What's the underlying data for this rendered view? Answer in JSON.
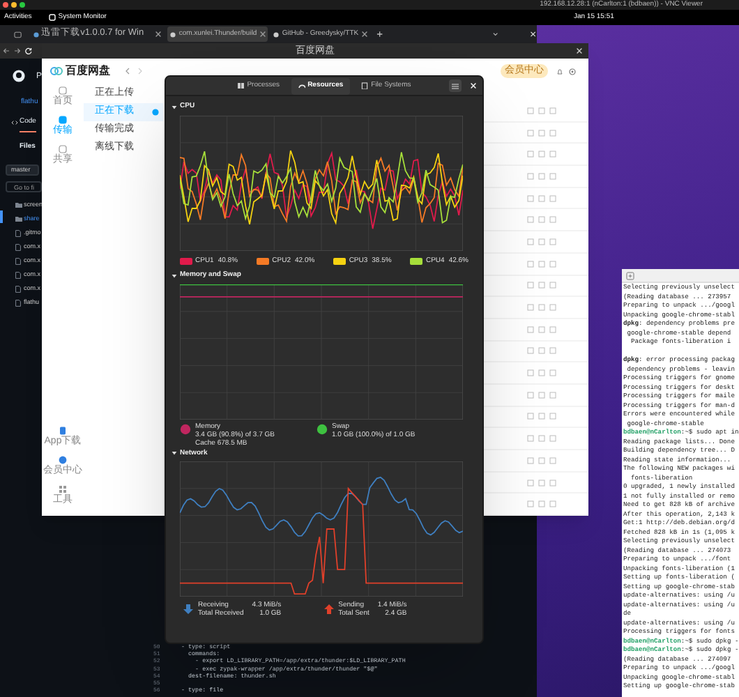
{
  "vnc_title": "192.168.12.28:1 (nCarlton:1 (bdbaen)) - VNC Viewer",
  "top_bar": {
    "activities": "Activities",
    "app": "System Monitor",
    "clock": "Jan 15  15:51"
  },
  "browser": {
    "tabs": [
      {
        "label": "迅雷下载v1.0.0.7 for Win",
        "selected": false
      },
      {
        "label": "com.xunlei.Thunder/build",
        "selected": true
      },
      {
        "label": "GitHub - Greedysky/TTK",
        "selected": false
      }
    ]
  },
  "github": {
    "header": "P",
    "repo": "flathu",
    "code_tab": "Code",
    "files_title": "Files",
    "branch": "master",
    "search_placeholder": "Go to fi",
    "tree": [
      {
        "name": "screen",
        "kind": "folder"
      },
      {
        "name": "share",
        "kind": "folder"
      },
      {
        "name": ".gitmo",
        "kind": "file"
      },
      {
        "name": "com.x",
        "kind": "file"
      },
      {
        "name": "com.x",
        "kind": "file"
      },
      {
        "name": "com.x",
        "kind": "file"
      },
      {
        "name": "com.x",
        "kind": "file"
      },
      {
        "name": "flathu",
        "kind": "file"
      }
    ]
  },
  "baidu": {
    "title": "百度网盘",
    "logo": "百度网盘",
    "vip": "会员中心",
    "nav": [
      {
        "label": "首页",
        "selected": false
      },
      {
        "label": "传输",
        "selected": true
      },
      {
        "label": "共享",
        "selected": false
      }
    ],
    "tools": [
      "App下载",
      "会员中心",
      "工具"
    ],
    "transfer_menu": [
      {
        "label": "正在上传",
        "selected": false
      },
      {
        "label": "正在下载",
        "selected": true
      },
      {
        "label": "传输完成",
        "selected": false
      },
      {
        "label": "离线下载",
        "selected": false
      }
    ]
  },
  "monitor": {
    "tabs": [
      {
        "label": "Processes",
        "selected": false
      },
      {
        "label": "Resources",
        "selected": true
      },
      {
        "label": "File Systems",
        "selected": false
      }
    ],
    "cpu": {
      "title": "CPU",
      "cores": [
        {
          "name": "CPU1",
          "value": "40.8%",
          "color": "#e01b4b"
        },
        {
          "name": "CPU2",
          "value": "42.0%",
          "color": "#f57a25"
        },
        {
          "name": "CPU3",
          "value": "38.5%",
          "color": "#f5d211"
        },
        {
          "name": "CPU4",
          "value": "42.6%",
          "color": "#a6de3a"
        }
      ]
    },
    "memory": {
      "title": "Memory and Swap",
      "items": [
        {
          "name": "Memory",
          "detail": "3.4 GB (90.8%) of 3.7 GB",
          "extra": "Cache 678.5 MB",
          "color": "#c0265f"
        },
        {
          "name": "Swap",
          "detail": "1.0 GB (100.0%) of 1.0 GB",
          "color": "#3ec140"
        }
      ]
    },
    "network": {
      "title": "Network",
      "items": [
        {
          "kind": "receive",
          "rate_label": "Receiving",
          "rate": "4.3 MiB/s",
          "total_label": "Total Received",
          "total": "1.0 GB",
          "color": "#3f7fc0"
        },
        {
          "kind": "send",
          "rate_label": "Sending",
          "rate": "1.4 MiB/s",
          "total_label": "Total Sent",
          "total": "2.4 GB",
          "color": "#e0402a"
        }
      ]
    }
  },
  "editor": {
    "lines": [
      {
        "number": "50",
        "text": "- type: script"
      },
      {
        "number": "51",
        "text": "  commands:"
      },
      {
        "number": "52",
        "text": "    - export LD_LIBRARY_PATH=/app/extra/thunder:$LD_LIBRARY_PATH"
      },
      {
        "number": "53",
        "text": "    - exec zypak-wrapper /app/extra/thunder/thunder \"$@\""
      },
      {
        "number": "54",
        "text": "  dest-filename: thunder.sh"
      },
      {
        "number": "55"
      },
      {
        "number": "56",
        "text": "- type: file"
      }
    ]
  },
  "terminal": {
    "lines": [
      {
        "kind": "out",
        "text": "Selecting previously unselect"
      },
      {
        "kind": "out",
        "text": "(Reading database ... 273957"
      },
      {
        "kind": "out",
        "text": "Preparing to unpack .../googl"
      },
      {
        "kind": "out",
        "text": "Unpacking google-chrome-stabl"
      },
      {
        "kind": "out",
        "text": "**dpkg**: dependency problems pre"
      },
      {
        "kind": "out",
        "text": " google-chrome-stable depend"
      },
      {
        "kind": "out",
        "text": "  Package fonts-liberation i"
      },
      {
        "kind": "out",
        "text": "**dpkg**: error processing packag",
        "gap_before": true
      },
      {
        "kind": "out",
        "text": " dependency problems - leavin"
      },
      {
        "kind": "out",
        "text": "Processing triggers for gnome"
      },
      {
        "kind": "out",
        "text": "Processing triggers for deskt"
      },
      {
        "kind": "out",
        "text": "Processing triggers for maile"
      },
      {
        "kind": "out",
        "text": "Processing triggers for man-d"
      },
      {
        "kind": "out",
        "text": "Errors were encountered while"
      },
      {
        "kind": "out",
        "text": " google-chrome-stable"
      },
      {
        "kind": "prompt",
        "prompt": "bdbaen@nCarlton",
        "text": ":~$ sudo apt in"
      },
      {
        "kind": "out",
        "text": "Reading package lists... Done"
      },
      {
        "kind": "out",
        "text": "Building dependency tree... D"
      },
      {
        "kind": "out",
        "text": "Reading state information..."
      },
      {
        "kind": "out",
        "text": "The following NEW packages wi"
      },
      {
        "kind": "out",
        "text": "  fonts-liberation"
      },
      {
        "kind": "out",
        "text": "0 upgraded, 1 newly installed"
      },
      {
        "kind": "out",
        "text": "1 not fully installed or remo"
      },
      {
        "kind": "out",
        "text": "Need to get 828 kB of archive"
      },
      {
        "kind": "out",
        "text": "After this operation, 2,143 k"
      },
      {
        "kind": "out",
        "text": "Get:1 http://deb.debian.org/d"
      },
      {
        "kind": "out",
        "text": "Fetched 828 kB in 1s (1,095 k"
      },
      {
        "kind": "out",
        "text": "Selecting previously unselect"
      },
      {
        "kind": "out",
        "text": "(Reading database ... 274073"
      },
      {
        "kind": "out",
        "text": "Preparing to unpack .../font"
      },
      {
        "kind": "out",
        "text": "Unpacking fonts-liberation (1"
      },
      {
        "kind": "out",
        "text": "Setting up fonts-liberation ("
      },
      {
        "kind": "out",
        "text": "Setting up google-chrome-stab"
      },
      {
        "kind": "out",
        "text": "update-alternatives: using /u"
      },
      {
        "kind": "out",
        "text": "update-alternatives: using /u"
      },
      {
        "kind": "out",
        "text": "de"
      },
      {
        "kind": "out",
        "text": "update-alternatives: using /u"
      },
      {
        "kind": "out",
        "text": "Processing triggers for fonts"
      },
      {
        "kind": "prompt",
        "prompt": "bdbaen@nCarlton",
        "text": ":~$ sudo dpkg -"
      },
      {
        "kind": "prompt",
        "prompt": "bdbaen@nCarlton",
        "text": ":~$ sudo dpkg -"
      },
      {
        "kind": "out",
        "text": "(Reading database ... 274097"
      },
      {
        "kind": "out",
        "text": "Preparing to unpack .../googl"
      },
      {
        "kind": "out",
        "text": "Unpacking google-chrome-stabl"
      },
      {
        "kind": "out",
        "text": "Setting up google-chrome-stab"
      }
    ]
  }
}
